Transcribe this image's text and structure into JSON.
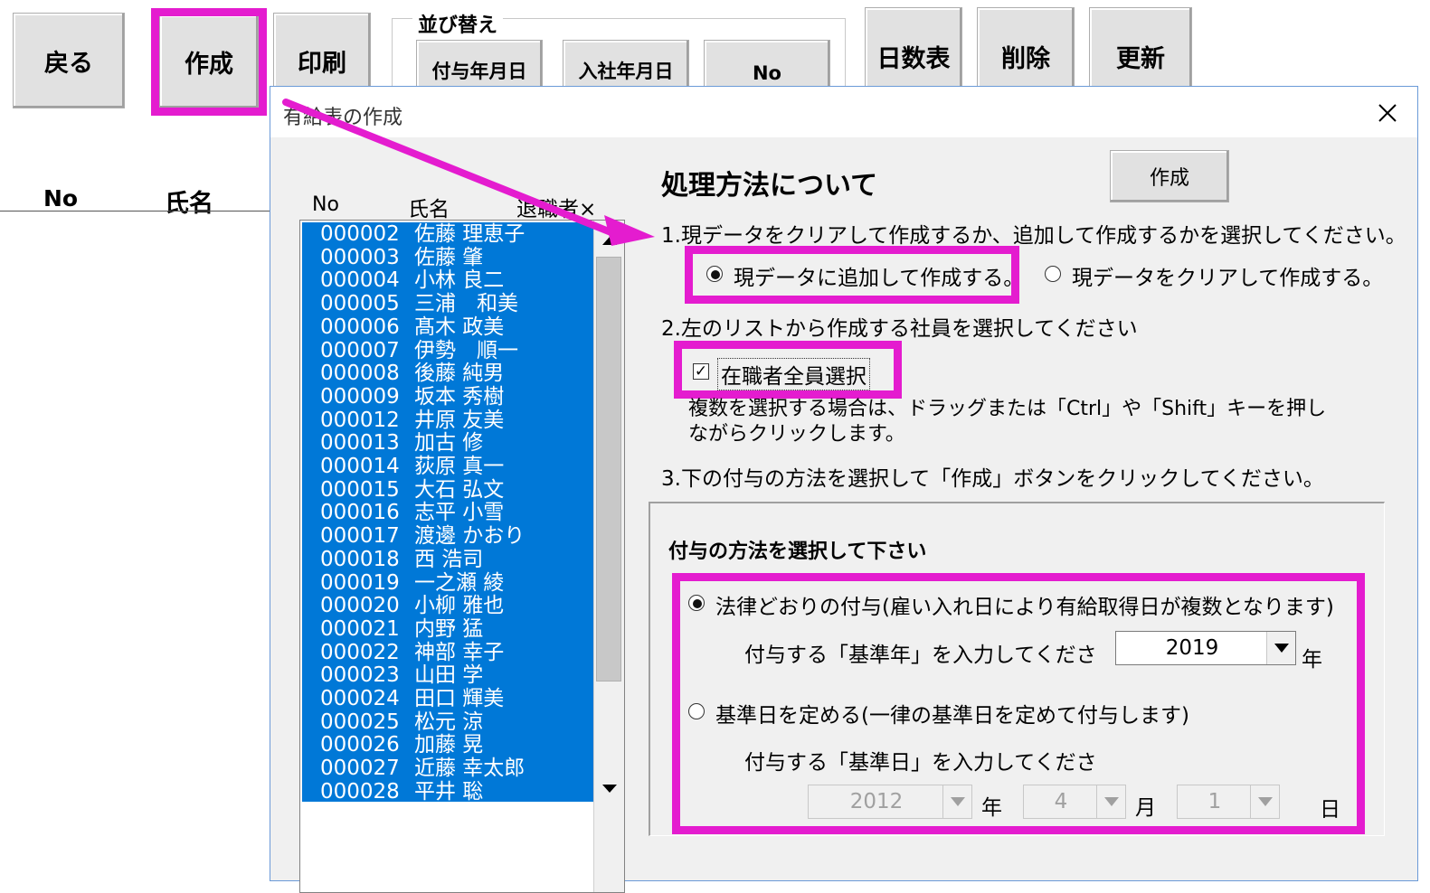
{
  "toolbar": {
    "back": "戻る",
    "create": "作成",
    "print": "印刷",
    "sort_label": "並び替え",
    "sort_grant_date": "付与年月日",
    "sort_hire_date": "入社年月日",
    "sort_no": "No",
    "days_table": "日数表",
    "delete": "削除",
    "update": "更新"
  },
  "sheet": {
    "col_no": "No",
    "col_name": "氏名"
  },
  "dialog": {
    "title": "有給表の作成",
    "close_icon": "close-icon",
    "create_button": "作成",
    "heading": "処理方法について",
    "step1": "1.現データをクリアして作成するか、追加して作成するかを選択してください。",
    "opt_append": "現データに追加して作成する。",
    "opt_clear": "現データをクリアして作成する。",
    "step2": "2.左のリストから作成する社員を選択してください",
    "select_all_label": "在職者全員選択",
    "help_text_1": "複数を選択する場合は、ドラッグまたは「Ctrl」や「Shift」キーを押し",
    "help_text_2": "ながらクリックします。",
    "step3": "3.下の付与の方法を選択して「作成」ボタンをクリックしてください。",
    "frame_title": "付与の方法を選択して下さい",
    "method_legal": "法律どおりの付与(雇い入れ日により有給取得日が複数となります)",
    "base_year_label": "付与する「基準年」を入力してくださ",
    "base_year_value": "2019",
    "year_unit": "年",
    "method_fixed": "基準日を定める(一律の基準日を定めて付与します)",
    "base_date_label": "付与する「基準日」を入力してくださ",
    "date_year": "2012",
    "date_month": "4",
    "date_day": "1",
    "month_unit": "月",
    "day_unit": "日"
  },
  "list": {
    "col_no": "No",
    "col_name": "氏名",
    "col_retired": "退職者×",
    "rows": [
      {
        "id": "000002",
        "name": "佐藤 理恵子"
      },
      {
        "id": "000003",
        "name": "佐藤 肇"
      },
      {
        "id": "000004",
        "name": "小林 良二"
      },
      {
        "id": "000005",
        "name": "三浦　和美"
      },
      {
        "id": "000006",
        "name": "髙木 政美"
      },
      {
        "id": "000007",
        "name": "伊勢　順一"
      },
      {
        "id": "000008",
        "name": "後藤 純男"
      },
      {
        "id": "000009",
        "name": "坂本 秀樹"
      },
      {
        "id": "000012",
        "name": "井原 友美"
      },
      {
        "id": "000013",
        "name": "加古 修"
      },
      {
        "id": "000014",
        "name": "荻原 真一"
      },
      {
        "id": "000015",
        "name": "大石 弘文"
      },
      {
        "id": "000016",
        "name": "志平 小雪"
      },
      {
        "id": "000017",
        "name": "渡邊 かおり"
      },
      {
        "id": "000018",
        "name": "西 浩司"
      },
      {
        "id": "000019",
        "name": "一之瀬 綾"
      },
      {
        "id": "000020",
        "name": "小柳 雅也"
      },
      {
        "id": "000021",
        "name": "内野 猛"
      },
      {
        "id": "000022",
        "name": "神部 幸子"
      },
      {
        "id": "000023",
        "name": "山田 学"
      },
      {
        "id": "000024",
        "name": "田口 輝美"
      },
      {
        "id": "000025",
        "name": "松元 涼"
      },
      {
        "id": "000026",
        "name": "加藤 晃"
      },
      {
        "id": "000027",
        "name": "近藤 幸太郎"
      },
      {
        "id": "000028",
        "name": "平井 聡"
      }
    ]
  },
  "colors": {
    "highlight": "#e41ccf",
    "selection": "#0078d7"
  }
}
